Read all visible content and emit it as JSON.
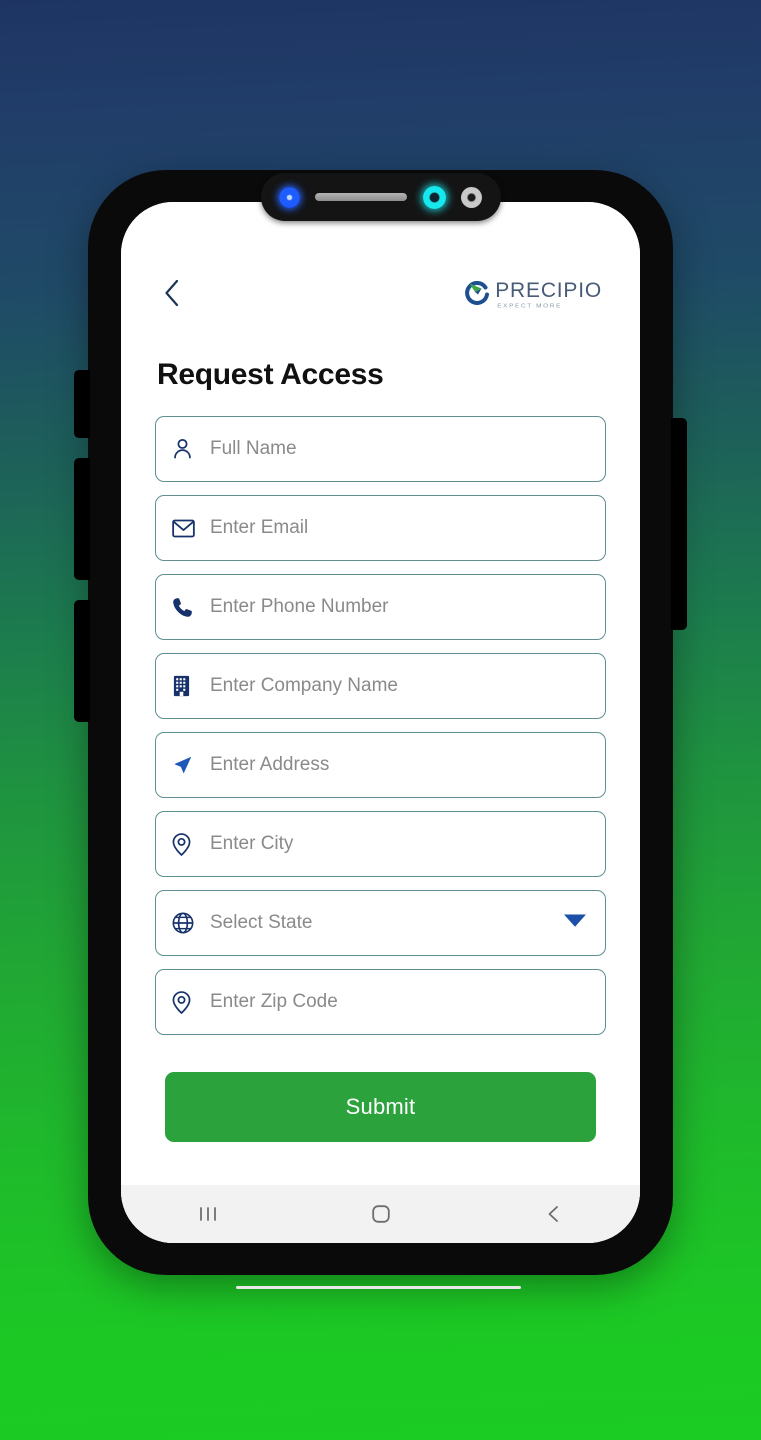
{
  "background": {
    "gradient_top_color": "#1e3563",
    "gradient_mid_color": "#1c7b4e",
    "gradient_bottom_color": "#1bcc23"
  },
  "device": {
    "frame_color": "#0a0a0a",
    "notch": {
      "led_indicator": "led-indicator",
      "earpiece_speaker": "speaker-grille",
      "front_camera": "front-camera",
      "proximity_sensor": "proximity-sensor"
    },
    "side_buttons": {
      "left_1": "silent-switch",
      "left_2": "volume-up-button",
      "left_3": "volume-down-button",
      "right_1": "power-button"
    }
  },
  "header": {
    "back_icon": "chevron-left-icon",
    "logo": {
      "mark_icon": "precipio-swoosh-logo",
      "wordmark": "PRECIPIO",
      "tagline": "EXPECT MORE",
      "mark_blue": "#1d4f91",
      "mark_green": "#3aa845",
      "word_color": "#4a5b78"
    }
  },
  "main": {
    "title": "Request Access",
    "fields": [
      {
        "name": "full-name",
        "icon": "user-icon",
        "placeholder": "Full Name",
        "value": "",
        "type": "text"
      },
      {
        "name": "email",
        "icon": "envelope-icon",
        "placeholder": "Enter Email",
        "value": "",
        "type": "email"
      },
      {
        "name": "phone",
        "icon": "phone-icon",
        "placeholder": "Enter Phone Number",
        "value": "",
        "type": "tel"
      },
      {
        "name": "company",
        "icon": "building-icon",
        "placeholder": "Enter Company Name",
        "value": "",
        "type": "text"
      },
      {
        "name": "address",
        "icon": "navigation-icon",
        "placeholder": "Enter Address",
        "value": "",
        "type": "text"
      },
      {
        "name": "city",
        "icon": "map-pin-icon",
        "placeholder": "Enter City",
        "value": "",
        "type": "text"
      },
      {
        "name": "state",
        "icon": "globe-icon",
        "placeholder": "Select State",
        "value": "",
        "type": "select"
      },
      {
        "name": "zip",
        "icon": "map-pin-icon",
        "placeholder": "Enter Zip Code",
        "value": "",
        "type": "text"
      }
    ],
    "dropdown_caret_icon": "caret-down-icon",
    "submit_label": "Submit",
    "submit_color": "#2ba23c",
    "field_border_color": "#5f8f90",
    "field_icon_color": "#17326b",
    "placeholder_color": "#8a8a8a"
  },
  "system_nav": {
    "recents_icon": "recents-icon",
    "home_icon": "home-icon",
    "back_icon": "back-icon"
  }
}
